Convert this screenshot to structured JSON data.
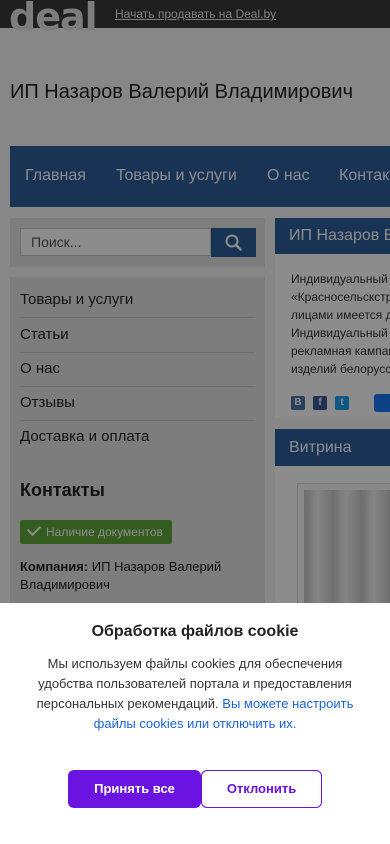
{
  "header": {
    "logo": "deal",
    "sell_link": "Начать продавать на Deal.by"
  },
  "company": {
    "title": "ИП Назаров Валерий Владимирович"
  },
  "nav": {
    "items": [
      {
        "label": "Главная"
      },
      {
        "label": "Товары и услуги"
      },
      {
        "label": "О нас"
      },
      {
        "label": "Контакты"
      }
    ]
  },
  "search": {
    "placeholder": "Поиск...",
    "icon": "search-icon"
  },
  "sidebar": {
    "items": [
      {
        "label": "Товары и услуги"
      },
      {
        "label": "Статьи"
      },
      {
        "label": "О нас"
      },
      {
        "label": "Отзывы"
      },
      {
        "label": "Доставка и оплата"
      }
    ],
    "contacts_heading": "Контакты",
    "docs_badge": "Наличие документов",
    "company_label": "Компания:",
    "company_value": "ИП Назаров Валерий Владимирович"
  },
  "main": {
    "heading": "ИП Назаров Валерий Владимирович",
    "about_lines": [
      "Индивидуальный предприниматель",
      "«Красносельскстройматериалы», с юридическими",
      "лицами имеется договор на поставку продукции.",
      "Индивидуальный предприниматель проводит",
      "рекламная кампания для продвижения",
      "изделий белорусских производителей"
    ],
    "social": [
      "vk-icon",
      "facebook-icon",
      "twitter-icon",
      "like-icon"
    ],
    "social_letters": [
      "В",
      "f",
      "t"
    ]
  },
  "vitrina": {
    "heading": "Витрина"
  },
  "cookie": {
    "title": "Обработка файлов cookie",
    "text": "Мы используем файлы cookies для обеспечения удобства пользователей портала и предоставления персональных рекомендаций.",
    "link": "Вы можете настроить файлы cookies или отключить их.",
    "accept": "Принять все",
    "decline": "Отклонить"
  },
  "colors": {
    "brand_blue": "#2f5d9c",
    "accept_purple": "#6b13e0",
    "docs_green": "#5fa83a",
    "link_blue": "#1c64d6"
  }
}
